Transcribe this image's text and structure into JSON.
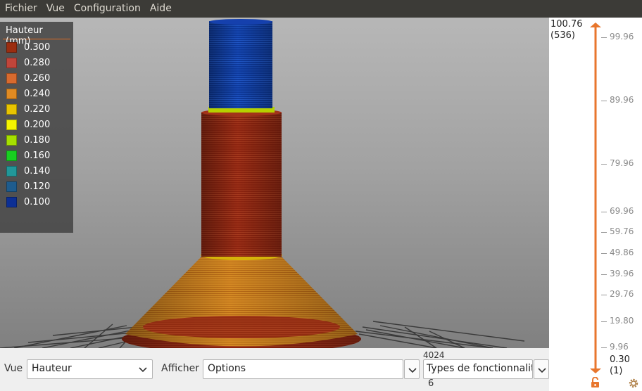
{
  "menu": [
    "Fichier",
    "Vue",
    "Configuration",
    "Aide"
  ],
  "legend": {
    "title": "Hauteur (mm)",
    "items": [
      {
        "label": "0.300",
        "color": "#9b2d10"
      },
      {
        "label": "0.280",
        "color": "#c1453a"
      },
      {
        "label": "0.260",
        "color": "#d86a2e"
      },
      {
        "label": "0.240",
        "color": "#e08a22"
      },
      {
        "label": "0.220",
        "color": "#e8c400"
      },
      {
        "label": "0.200",
        "color": "#f4f400"
      },
      {
        "label": "0.180",
        "color": "#a6e000"
      },
      {
        "label": "0.160",
        "color": "#18d020"
      },
      {
        "label": "0.140",
        "color": "#219799"
      },
      {
        "label": "0.120",
        "color": "#1e5c8e"
      },
      {
        "label": "0.100",
        "color": "#0c2f94"
      }
    ]
  },
  "bottom": {
    "view_label": "Vue",
    "view_value": "Hauteur",
    "show_label": "Afficher",
    "show_value": "Options",
    "features_value": "Types de fonctionnalit",
    "count_top": "4024",
    "count_bottom": "6"
  },
  "slider": {
    "top_value": "100.76",
    "top_layer": "(536)",
    "bottom_value": "0.30",
    "bottom_layer": "(1)",
    "accent": "#e8762d",
    "ticks": [
      "99.96",
      "89.96",
      "79.96",
      "69.96",
      "59.76",
      "49.86",
      "39.96",
      "29.76",
      "19.80",
      "9.96"
    ]
  }
}
